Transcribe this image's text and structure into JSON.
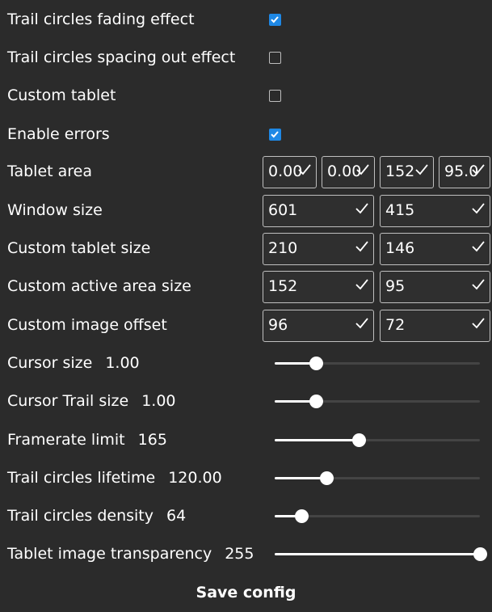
{
  "checkboxes": [
    {
      "label": "Trail circles fading effect",
      "checked": true
    },
    {
      "label": "Trail circles spacing out effect",
      "checked": false
    },
    {
      "label": "Custom tablet",
      "checked": false
    },
    {
      "label": "Enable errors",
      "checked": true
    }
  ],
  "tablet_area": {
    "label": "Tablet area",
    "values": [
      "0.00",
      "0.00",
      "152",
      "95.0"
    ]
  },
  "window_size": {
    "label": "Window size",
    "values": [
      "601",
      "415"
    ]
  },
  "custom_tablet_size": {
    "label": "Custom tablet size",
    "values": [
      "210",
      "146"
    ]
  },
  "custom_active_area_size": {
    "label": "Custom active area size",
    "values": [
      "152",
      "95"
    ]
  },
  "custom_image_offset": {
    "label": "Custom image offset",
    "values": [
      "96",
      "72"
    ]
  },
  "sliders": [
    {
      "label": "Cursor size",
      "value": "1.00",
      "fraction": 0.2
    },
    {
      "label": "Cursor Trail size",
      "value": "1.00",
      "fraction": 0.2
    },
    {
      "label": "Framerate limit",
      "value": "165",
      "fraction": 0.41
    },
    {
      "label": "Trail circles lifetime",
      "value": "120.00",
      "fraction": 0.25
    },
    {
      "label": "Trail circles density",
      "value": "64",
      "fraction": 0.13
    },
    {
      "label": "Tablet image transparency",
      "value": "255",
      "fraction": 1.0
    }
  ],
  "save_label": "Save config",
  "colors": {
    "accent": "#1e88e5",
    "background": "#2b2b2b"
  }
}
